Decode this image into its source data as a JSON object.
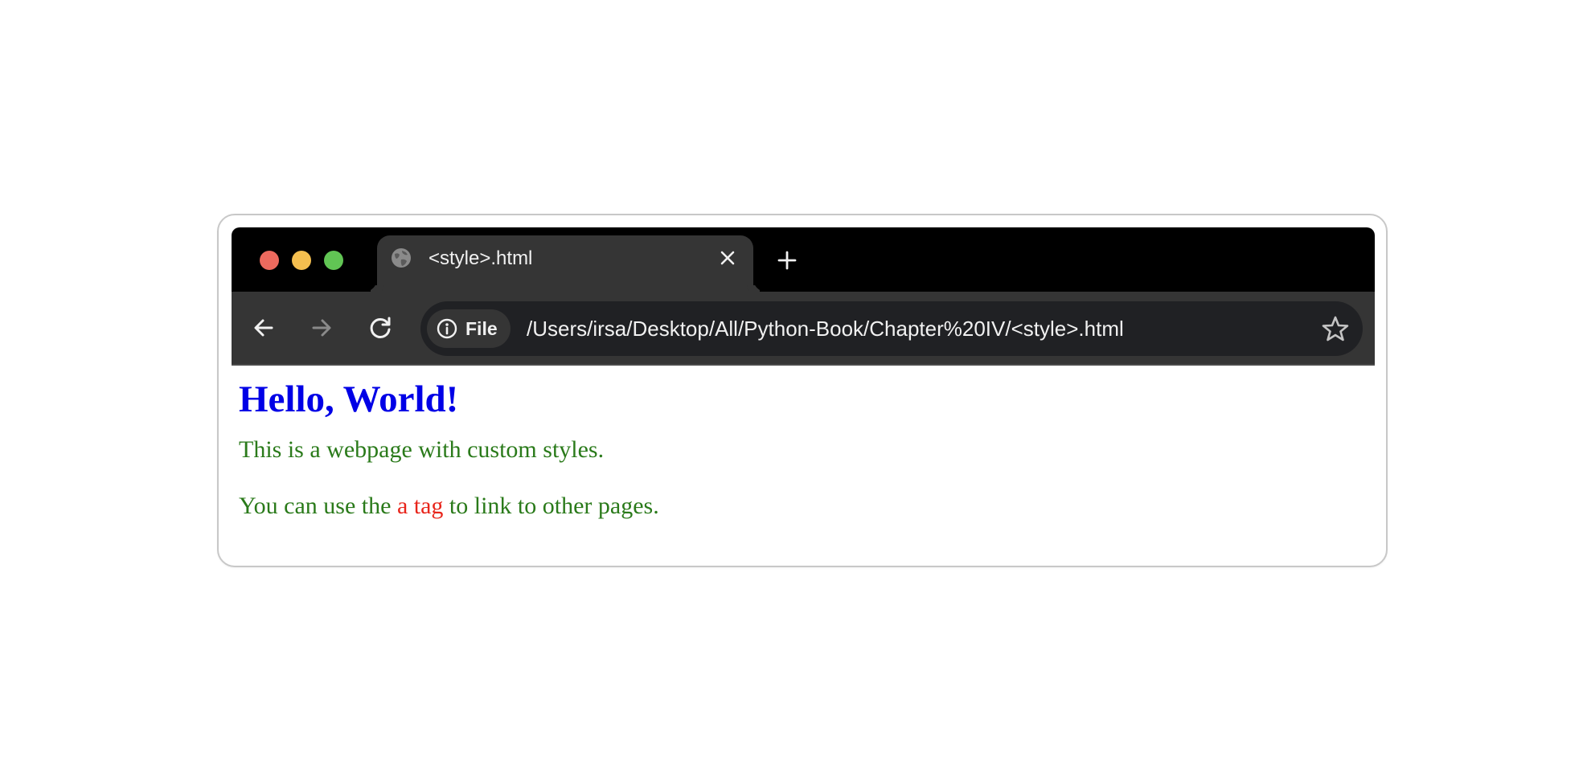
{
  "browser": {
    "tab": {
      "title": "<style>.html",
      "favicon": "globe-icon"
    },
    "address_bar": {
      "scheme_chip": "File",
      "url": "/Users/irsa/Desktop/All/Python-Book/Chapter%20IV/<style>.html"
    },
    "icons": {
      "back": "arrow-left-icon",
      "forward": "arrow-right-icon",
      "reload": "reload-icon",
      "info": "info-icon",
      "bookmark": "star-icon",
      "close": "close-icon",
      "new_tab": "plus-icon"
    },
    "nav_state": {
      "back_enabled": true,
      "forward_enabled": false
    }
  },
  "page": {
    "heading": "Hello, World!",
    "paragraph1": "This is a webpage with custom styles.",
    "paragraph2": {
      "before": "You can use the ",
      "link": "a tag",
      "after": " to link to other pages."
    }
  },
  "colors": {
    "heading": "#0000e6",
    "paragraph": "#2a7a1a",
    "link": "#e8251b",
    "chrome_dark": "#353535",
    "tabbar": "#000000",
    "omnibox": "#202124",
    "traffic_red": "#ed6a5e",
    "traffic_yellow": "#f5bf4f",
    "traffic_green": "#61c554"
  }
}
